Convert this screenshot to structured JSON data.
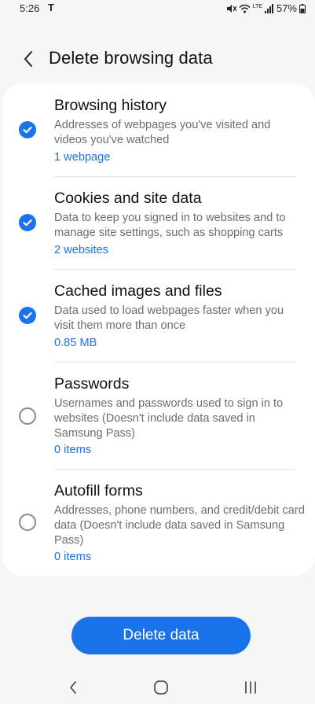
{
  "status_bar": {
    "time": "5:26",
    "carrier_icon": "T",
    "battery": "57%",
    "network": "LTE"
  },
  "header": {
    "title": "Delete browsing data"
  },
  "items": [
    {
      "title": "Browsing history",
      "description": "Addresses of webpages you've visited and videos you've watched",
      "count": "1 webpage",
      "checked": true
    },
    {
      "title": "Cookies and site data",
      "description": "Data to keep you signed in to websites and to manage site settings, such as shopping carts",
      "count": "2 websites",
      "checked": true
    },
    {
      "title": "Cached images and files",
      "description": "Data used to load webpages faster when you visit them more than once",
      "count": "0.85 MB",
      "checked": true
    },
    {
      "title": "Passwords",
      "description": "Usernames and passwords used to sign in to websites (Doesn't include data saved in Samsung Pass)",
      "count": "0 items",
      "checked": false
    },
    {
      "title": "Autofill forms",
      "description": "Addresses, phone numbers, and credit/debit card data (Doesn't include data saved in Samsung Pass)",
      "count": "0 items",
      "checked": false
    }
  ],
  "delete_button": {
    "label": "Delete data"
  },
  "colors": {
    "accent": "#1a73e8",
    "background": "#f6f6f6",
    "card": "#ffffff"
  }
}
